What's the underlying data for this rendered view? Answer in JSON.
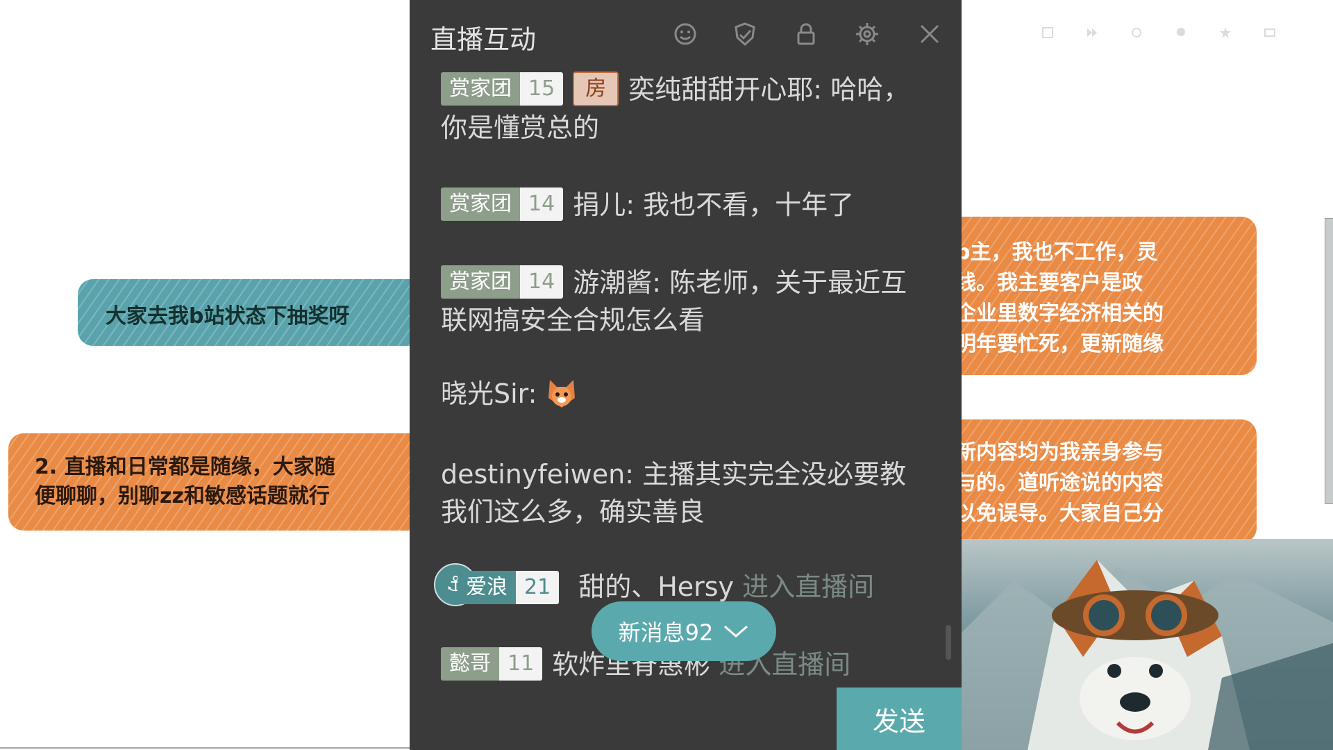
{
  "background": {
    "notes": {
      "teal": "大家去我b站状态下抽奖呀",
      "orange_left_line1": "2. 直播和日常都是随缘，大家随",
      "orange_left_line2": "便聊聊，别聊zz和敏感话题就行",
      "orange_right1_line1": "p主，我也不工作，灵",
      "orange_right1_line2": "线。我主要客户是政",
      "orange_right1_line3": "企业里数字经济相关的",
      "orange_right1_line4": "明年要忙死，更新随缘",
      "orange_right2_line1": "新内容均为我亲身参与",
      "orange_right2_line2": "与的。道听途说的内容",
      "orange_right2_line3": "以免误导。大家自己分"
    },
    "accent_teal": "#5aa3ac",
    "accent_orange": "#e98a45"
  },
  "panel": {
    "title": "直播互动",
    "header_icons": [
      "emoji-icon",
      "shield-icon",
      "lock-icon",
      "gear-icon",
      "close-icon"
    ],
    "messages": [
      {
        "badge_name": "赏家团",
        "badge_level": "15",
        "room_tag": "房",
        "user": "奕纯甜甜开心耶",
        "text": "哈哈，你是懂赏总的"
      },
      {
        "badge_name": "赏家团",
        "badge_level": "14",
        "user": "捐儿",
        "text": "我也不看，十年了"
      },
      {
        "badge_name": "赏家团",
        "badge_level": "14",
        "user": "游潮酱",
        "text": "陈老师，关于最近互联网搞安全合规怎么看"
      },
      {
        "user": "晓光Sir",
        "emoji": "cat-emoji"
      },
      {
        "user": "destinyfeiwen",
        "text": "主播其实完全没必要教我们这么多，确实善良"
      },
      {
        "badge_name": "爱浪",
        "badge_level": "21",
        "user": "甜的、Hersy",
        "system": "进入直播间"
      },
      {
        "badge_name": "懿哥",
        "badge_level": "11",
        "user": "软炸里脊惠彬",
        "system": "进入直播间"
      }
    ],
    "new_messages_label": "新消息92",
    "send_label": "发送"
  }
}
